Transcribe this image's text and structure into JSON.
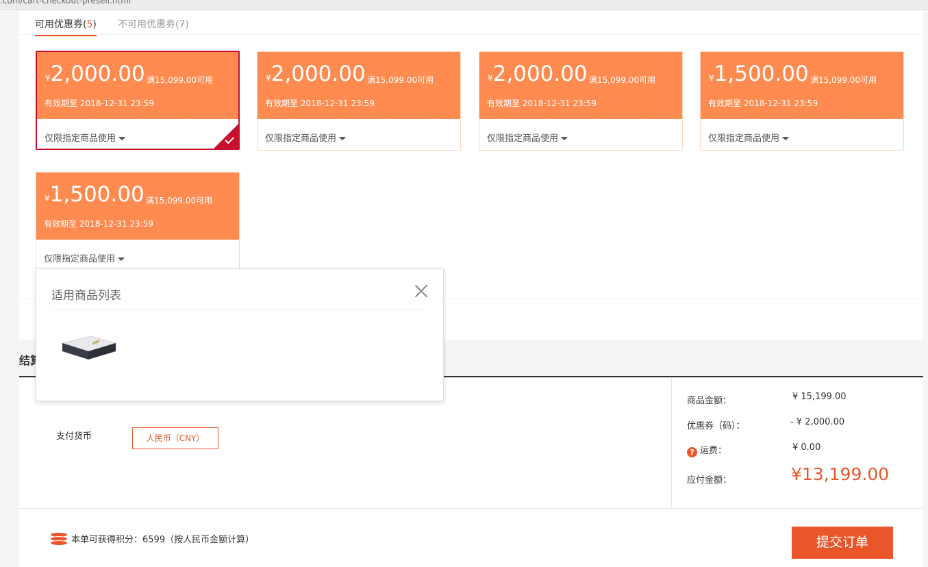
{
  "browser": {
    "url_fragment": ".com/cart-checkout-presell.html"
  },
  "coupon_tabs": {
    "available_label": "可用优惠券",
    "available_count": "5",
    "unavailable_label": "不可用优惠券",
    "unavailable_count": "7"
  },
  "coupons": [
    {
      "currency": "¥",
      "amount": "2,000.00",
      "condition": "满15,099.00可用",
      "expiry": "有效期至  2018-12-31 23:59",
      "scope": "仅限指定商品使用",
      "selected": true
    },
    {
      "currency": "¥",
      "amount": "2,000.00",
      "condition": "满15,099.00可用",
      "expiry": "有效期至  2018-12-31 23:59",
      "scope": "仅限指定商品使用",
      "selected": false
    },
    {
      "currency": "¥",
      "amount": "2,000.00",
      "condition": "满15,099.00可用",
      "expiry": "有效期至  2018-12-31 23:59",
      "scope": "仅限指定商品使用",
      "selected": false
    },
    {
      "currency": "¥",
      "amount": "1,500.00",
      "condition": "满15,099.00可用",
      "expiry": "有效期至  2018-12-31 23:59",
      "scope": "仅限指定商品使用",
      "selected": false
    },
    {
      "currency": "¥",
      "amount": "1,500.00",
      "condition": "满15,099.00可用",
      "expiry": "有效期至  2018-12-31 23:59",
      "scope": "仅限指定商品使用",
      "selected": false
    }
  ],
  "popup": {
    "title": "适用商品列表",
    "product_image": "mattress-product-image"
  },
  "settlement": {
    "title": "结算",
    "currency_label": "支付货币",
    "currency_option": "人民币（CNY）",
    "goods_amount_label": "商品金额：",
    "goods_amount_value": "¥ 15,199.00",
    "coupon_label": "优惠券（码）：",
    "coupon_value": "- ¥ 2,000.00",
    "shipping_label": "运费：",
    "shipping_value": "¥ 0.00",
    "payable_label": "应付金额：",
    "payable_value": "¥13,199.00",
    "points_text": "本单可获得积分：6599（按人民币金额计算）",
    "submit_label": "提交订单"
  },
  "colors": {
    "accent": "#e8562a",
    "coupon_bg": "#ff8b50",
    "selected_border": "#c8102e"
  }
}
